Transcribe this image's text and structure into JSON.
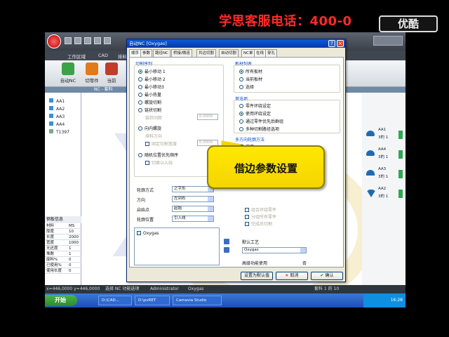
{
  "banner": {
    "text": "学思客服电话：400-0",
    "logo": "优酷"
  },
  "app": {
    "ribbon_tabs": [
      "工作区域",
      "CAD",
      "排料"
    ],
    "ribbon_buttons": [
      {
        "label": "自动NC",
        "icon": "auto-nc-icon",
        "color": "#3aa347"
      },
      {
        "label": "切零件",
        "icon": "cut-part-icon",
        "color": "#e07a1b"
      },
      {
        "label": "当前",
        "icon": "current-icon",
        "color": "#c23b2b"
      }
    ],
    "strip_label": "NC - 套料",
    "tree": [
      "AA1",
      "AA2",
      "AA3",
      "AA4",
      "T1397"
    ],
    "props_header": "钢板信息",
    "props": [
      {
        "k": "材料",
        "v": "MS"
      },
      {
        "k": "厚度",
        "v": "10"
      },
      {
        "k": "长度",
        "v": "2000"
      },
      {
        "k": "宽度",
        "v": "1000"
      },
      {
        "k": "无还度",
        "v": "1"
      },
      {
        "k": "堆数",
        "v": "1"
      },
      {
        "k": "废料%",
        "v": "0"
      },
      {
        "k": "已使用%",
        "v": "0"
      },
      {
        "k": "使用长度",
        "v": "0"
      }
    ],
    "parts": [
      {
        "name": "AA1",
        "count": "3的 1"
      },
      {
        "name": "AA4",
        "count": "3的 1"
      },
      {
        "name": "AA3",
        "count": "3的 1"
      },
      {
        "name": "AA2",
        "count": "3的 1"
      }
    ],
    "status": {
      "coords": "x=446,0000 y=446,0000",
      "hint": "选择 NC 功能选项",
      "user": "Administrator",
      "mode": "Oxygas",
      "page": "套料 1 的 10"
    },
    "taskbar": {
      "start": "开始",
      "tasks": [
        "D:\\CAD...",
        "D:\\pvRET",
        "Camavia Studio"
      ],
      "clock": "16:28"
    }
  },
  "dialog": {
    "title": "自动NC [Oxygas]",
    "tabs": [
      "顺序",
      "参数",
      "路径NC",
      "桥接/微连",
      "共边切割",
      "自动切割",
      "NC单",
      "在线",
      "穿孔"
    ],
    "cut_order_label": "切割序列",
    "cut_order_options": [
      {
        "label": "最小移动 1",
        "selected": true
      },
      {
        "label": "最小移动 2",
        "selected": false
      },
      {
        "label": "最小移动3",
        "selected": false
      },
      {
        "label": "最小热量",
        "selected": false
      },
      {
        "label": "螺旋切割",
        "selected": false
      },
      {
        "label": "链状切割",
        "selected": false
      },
      {
        "label": "向内螺旋",
        "selected": false
      },
      {
        "label": "随机位置优先顺序",
        "selected": false
      }
    ],
    "sub_opts": [
      "链状间距",
      "排料方向",
      "固定切割宽度",
      "切换以入线"
    ],
    "small_value": "0.0000",
    "sheet_list_label": "板材列表",
    "sheet_options": [
      {
        "label": "所有板材",
        "selected": true
      },
      {
        "label": "当前板材",
        "selected": false
      },
      {
        "label": "选择",
        "selected": false
      }
    ],
    "first_label": "首选项",
    "first_options": [
      {
        "label": "零件环绕设定",
        "selected": false
      },
      {
        "label": "使用环绕设定",
        "selected": true
      },
      {
        "label": "通过零件优先后群组",
        "selected": false
      },
      {
        "label": "多种切割路径选项",
        "selected": false
      }
    ],
    "multi_label": "多方向轮廓方法",
    "multi_check": "使用",
    "strategy_label": "轮廓方式",
    "strategy_value": "之字形",
    "dir_label": "方向",
    "dir_value": "左到右",
    "start_label": "启始点",
    "start_value": "起始",
    "pos_label": "轮廓位置",
    "pos_value": "引入线",
    "process_item": "Oxygas",
    "default_process_label": "默认工艺",
    "default_process_value": "Oxygas",
    "advanced_label": "高级功能使用",
    "advanced_value": "否",
    "right_checks": [
      "组合环绕零件",
      "分组所有零件",
      "完成后切割"
    ],
    "btn_default": "设置为默认值",
    "btn_cancel": "取消",
    "btn_ok": "确认"
  },
  "callout": {
    "text": "借边参数设置"
  }
}
